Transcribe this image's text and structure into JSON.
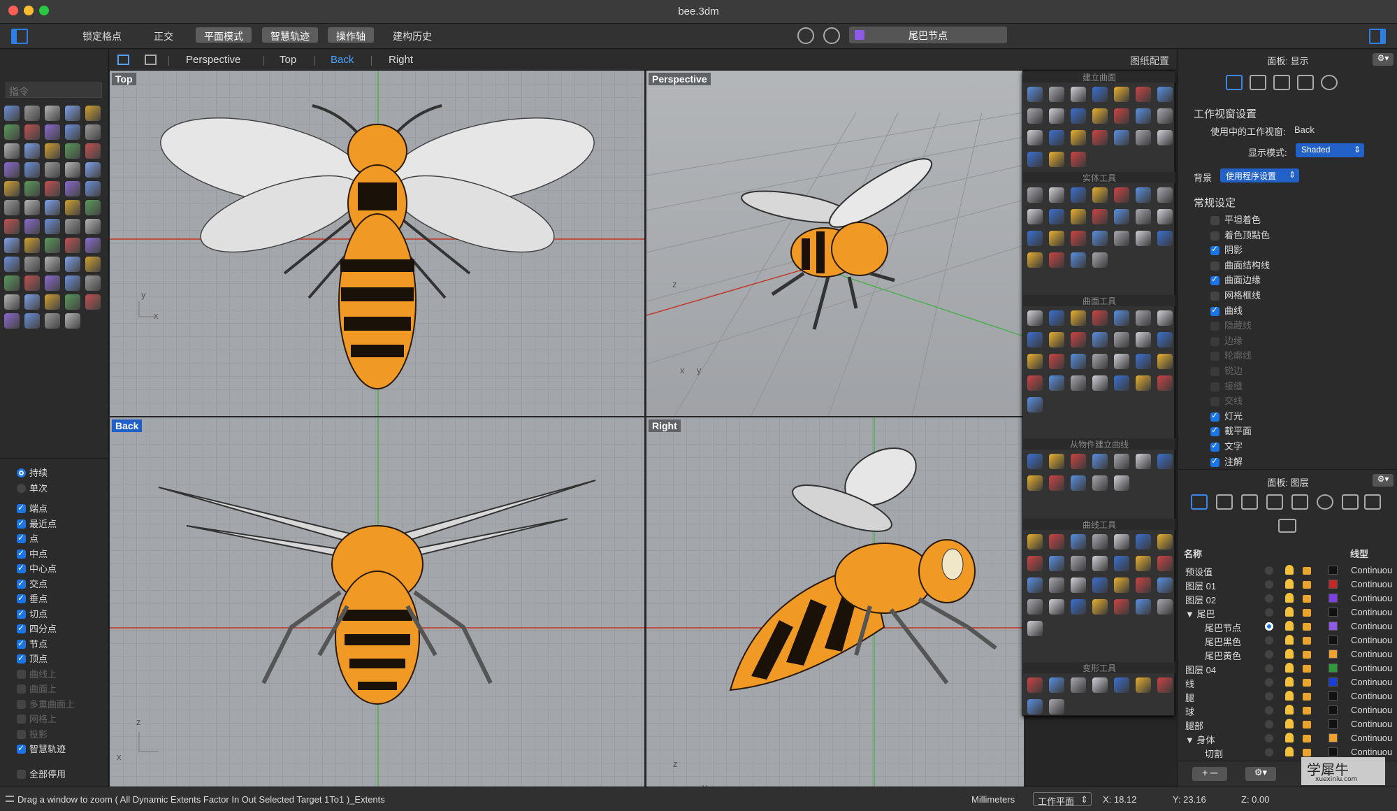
{
  "window": {
    "title": "bee.3dm"
  },
  "toolbar": {
    "items": [
      "锁定格点",
      "正交",
      "平面模式",
      "智慧轨迹",
      "操作轴",
      "建构历史"
    ],
    "current_layer": "尾巴节点",
    "current_layer_color": "#8e5ae8"
  },
  "command": {
    "placeholder": "指令"
  },
  "viewport_tabs": {
    "tabs": [
      "Perspective",
      "Top",
      "Back",
      "Right"
    ],
    "active": "Back",
    "layout_button": "图纸配置"
  },
  "viewports": {
    "top": {
      "label": "Top",
      "axis_a": "y",
      "axis_b": "x"
    },
    "perspective": {
      "label": "Perspective",
      "axis_a": "z",
      "axis_b": "x",
      "axis_c": "y"
    },
    "back": {
      "label": "Back",
      "axis_a": "z",
      "axis_b": "x"
    },
    "right": {
      "label": "Right",
      "axis_a": "z",
      "axis_b": "y"
    }
  },
  "palette": {
    "sections": [
      "建立曲面",
      "实体工具",
      "曲面工具",
      "从物件建立曲线",
      "曲线工具",
      "变形工具"
    ]
  },
  "snaps": {
    "modes": [
      {
        "label": "持续",
        "on": true
      },
      {
        "label": "单次",
        "on": false
      }
    ],
    "items": [
      {
        "label": "端点",
        "on": true
      },
      {
        "label": "最近点",
        "on": true
      },
      {
        "label": "点",
        "on": true
      },
      {
        "label": "中点",
        "on": true
      },
      {
        "label": "中心点",
        "on": true
      },
      {
        "label": "交点",
        "on": true
      },
      {
        "label": "垂点",
        "on": true
      },
      {
        "label": "切点",
        "on": true
      },
      {
        "label": "四分点",
        "on": true
      },
      {
        "label": "节点",
        "on": true
      },
      {
        "label": "顶点",
        "on": true
      },
      {
        "label": "曲线上",
        "on": false
      },
      {
        "label": "曲面上",
        "on": false
      },
      {
        "label": "多重曲面上",
        "on": false
      },
      {
        "label": "网格上",
        "on": false
      },
      {
        "label": "投影",
        "on": false
      },
      {
        "label": "智慧轨迹",
        "on": true
      }
    ],
    "disable_all": "全部停用"
  },
  "display_panel": {
    "title": "面板: 显示",
    "viewport_settings": "工作视窗设置",
    "active_viewport_label": "使用中的工作视窗:",
    "active_viewport": "Back",
    "display_mode_label": "显示模式:",
    "display_mode": "Shaded",
    "background_label": "背景",
    "background": "使用程序设置",
    "general": "常规设定",
    "options": [
      {
        "label": "平坦着色",
        "state": "off"
      },
      {
        "label": "着色顶點色",
        "state": "off"
      },
      {
        "label": "阴影",
        "state": "on"
      },
      {
        "label": "曲面结构线",
        "state": "off"
      },
      {
        "label": "曲面边缘",
        "state": "on"
      },
      {
        "label": "网格框线",
        "state": "off"
      },
      {
        "label": "曲线",
        "state": "on"
      },
      {
        "label": "隐藏线",
        "state": "dim"
      },
      {
        "label": "边缘",
        "state": "dim"
      },
      {
        "label": "轮廓线",
        "state": "dim"
      },
      {
        "label": "锐边",
        "state": "dim"
      },
      {
        "label": "接缝",
        "state": "dim"
      },
      {
        "label": "交线",
        "state": "dim"
      },
      {
        "label": "灯光",
        "state": "on"
      },
      {
        "label": "截平面",
        "state": "on"
      },
      {
        "label": "文字",
        "state": "on"
      },
      {
        "label": "注解",
        "state": "on"
      }
    ]
  },
  "layers_panel": {
    "title": "面板: 图层",
    "col_name": "名称",
    "col_linetype": "线型",
    "rows": [
      {
        "name": "预设值",
        "indent": 0,
        "color": "#111111",
        "linetype": "Continuou",
        "current": false
      },
      {
        "name": "图层 01",
        "indent": 0,
        "color": "#c62828",
        "linetype": "Continuou",
        "current": false
      },
      {
        "name": "图层 02",
        "indent": 0,
        "color": "#7b3fe4",
        "linetype": "Continuou",
        "current": false
      },
      {
        "name": "▼ 尾巴",
        "indent": 0,
        "color": "#111111",
        "linetype": "Continuou",
        "current": false
      },
      {
        "name": "尾巴节点",
        "indent": 1,
        "color": "#8e5ae8",
        "linetype": "Continuou",
        "current": true
      },
      {
        "name": "尾巴黑色",
        "indent": 1,
        "color": "#111111",
        "linetype": "Continuou",
        "current": false
      },
      {
        "name": "尾巴黄色",
        "indent": 1,
        "color": "#f0a030",
        "linetype": "Continuou",
        "current": false
      },
      {
        "name": "图层 04",
        "indent": 0,
        "color": "#2e9b3a",
        "linetype": "Continuou",
        "current": false
      },
      {
        "name": "线",
        "indent": 0,
        "color": "#1a3fd8",
        "linetype": "Continuou",
        "current": false
      },
      {
        "name": "腿",
        "indent": 0,
        "color": "#111111",
        "linetype": "Continuou",
        "current": false
      },
      {
        "name": "球",
        "indent": 0,
        "color": "#111111",
        "linetype": "Continuou",
        "current": false
      },
      {
        "name": "腿部",
        "indent": 0,
        "color": "#111111",
        "linetype": "Continuou",
        "current": false
      },
      {
        "name": "▼ 身体",
        "indent": 0,
        "color": "#f0a030",
        "linetype": "Continuou",
        "current": false
      },
      {
        "name": "切割",
        "indent": 1,
        "color": "#111111",
        "linetype": "Continuou",
        "current": false
      }
    ]
  },
  "status": {
    "prompt": "Drag a window to zoom ( All Dynamic Extents Factor In Out Selected Target 1To1 )_Extents",
    "units": "Millimeters",
    "cplane": "工作平面",
    "x": "X: 18.12",
    "y": "Y: 23.16",
    "z": "Z: 0.00"
  },
  "watermark": {
    "text": "学犀牛",
    "sub": "xuexiniu.com"
  }
}
